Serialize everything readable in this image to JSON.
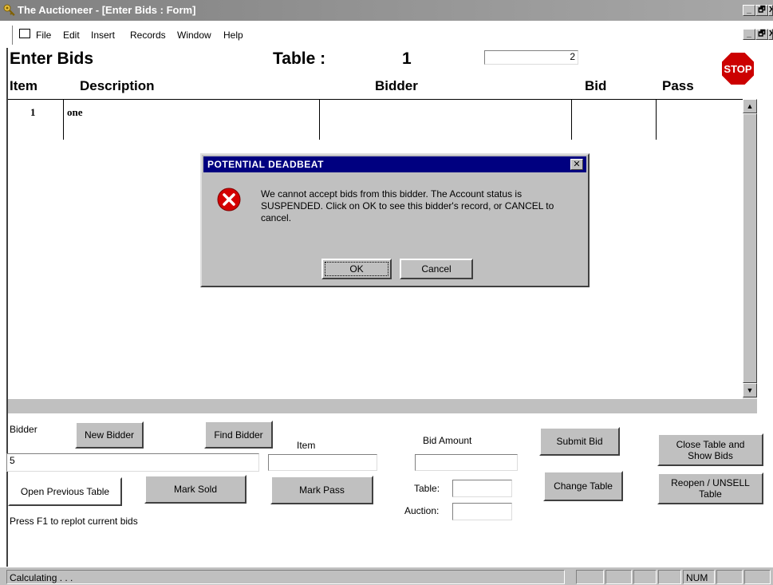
{
  "window": {
    "title": "The Auctioneer - [Enter Bids : Form]",
    "controls": [
      "_",
      "🗗",
      "X"
    ]
  },
  "menu": {
    "items": [
      "File",
      "Edit",
      "Insert",
      "Records",
      "Window",
      "Help"
    ],
    "controls": [
      "_",
      "🗗",
      "X"
    ]
  },
  "form": {
    "heading": "Enter Bids",
    "table_label": "Table :",
    "table_number": "1",
    "table_field_value": "2",
    "stop_sign": "STOP"
  },
  "grid": {
    "columns": [
      "Item",
      "Description",
      "Bidder",
      "Bid",
      "Pass"
    ],
    "rows": [
      {
        "item": "1",
        "description": "one",
        "bidder": "",
        "bid": "",
        "pass": ""
      }
    ]
  },
  "dialog": {
    "title": "POTENTIAL DEADBEAT",
    "message": "We cannot accept bids from this bidder.  The Account status is SUSPENDED.  Click on OK to see this bidder's record, or CANCEL to cancel.",
    "ok_label": "OK",
    "cancel_label": "Cancel",
    "close_label": "✕"
  },
  "bottom": {
    "bidder_label": "Bidder",
    "bidder_value": "5",
    "new_bidder_label": "New Bidder",
    "find_bidder_label": "Find Bidder",
    "item_label": "Item",
    "item_value": "",
    "bid_amount_label": "Bid Amount",
    "bid_amount_value": "",
    "submit_bid_label": "Submit Bid",
    "close_table_label": "Close Table and\nShow Bids",
    "open_previous_label": "Open Previous Table",
    "mark_sold_label": "Mark Sold",
    "mark_pass_label": "Mark Pass",
    "table_label": "Table:",
    "table_value": "",
    "auction_label": "Auction:",
    "auction_value": "",
    "change_table_label": "Change Table",
    "reopen_label": "Reopen / UNSELL\nTable",
    "hint": "Press F1 to replot current bids"
  },
  "status": {
    "message": "Calculating . . .",
    "num": "NUM"
  },
  "colors": {
    "title_bar": "#808080",
    "dialog_title": "#000080",
    "button_face": "#c0c0c0",
    "stop_red": "#cc0000",
    "error_red": "#d40000"
  }
}
